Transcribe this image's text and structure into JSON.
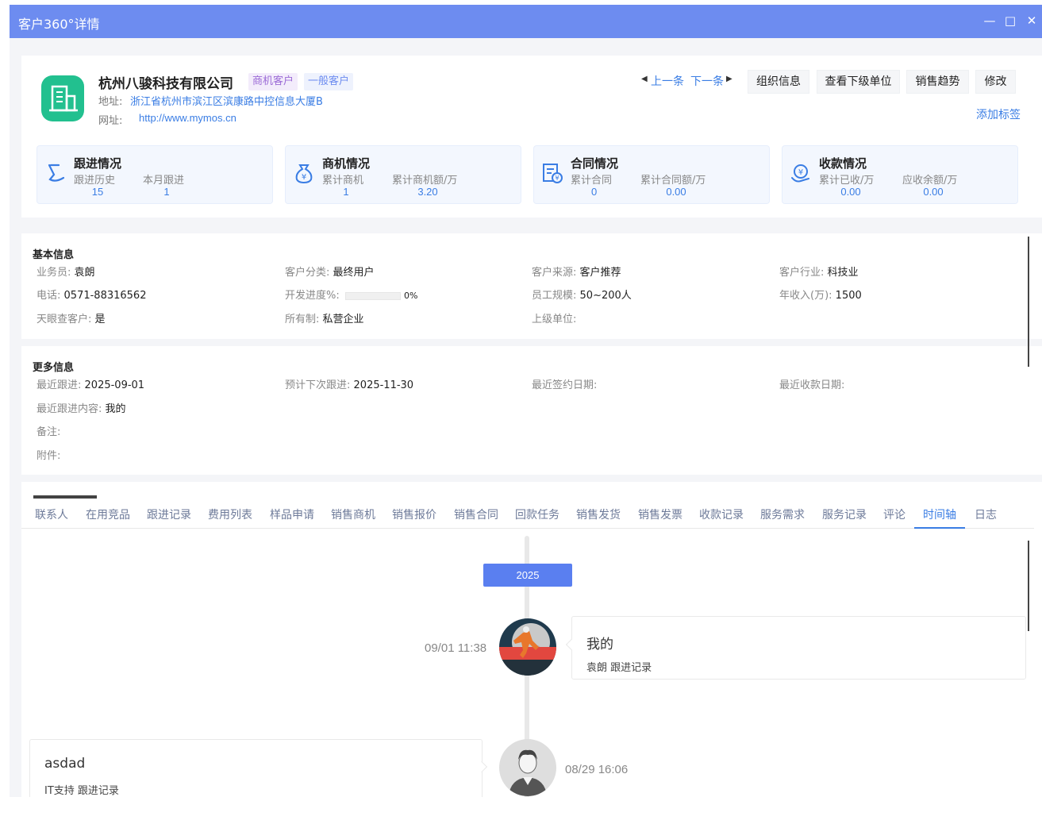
{
  "window": {
    "title": "客户360°详情"
  },
  "company": {
    "name": "杭州八骏科技有限公司",
    "tag1": "商机客户",
    "tag2": "一般客户",
    "address_label": "地址:",
    "address": "浙江省杭州市滨江区滨康路中控信息大厦B",
    "url_label": "网址:",
    "url": "http://www.mymos.cn"
  },
  "nav": {
    "prev": "上一条",
    "next": "下一条"
  },
  "buttons": {
    "org_info": "组织信息",
    "sub_units": "查看下级单位",
    "sales_trend": "销售趋势",
    "edit": "修改",
    "add_tag": "添加标签"
  },
  "cards": [
    {
      "title": "跟进情况",
      "label1": "跟进历史",
      "value1": "15",
      "label2": "本月跟进",
      "value2": "1"
    },
    {
      "title": "商机情况",
      "label1": "累计商机",
      "value1": "1",
      "label2": "累计商机额/万",
      "value2": "3.20"
    },
    {
      "title": "合同情况",
      "label1": "累计合同",
      "value1": "0",
      "label2": "累计合同额/万",
      "value2": "0.00"
    },
    {
      "title": "收款情况",
      "label1": "累计已收/万",
      "value1": "0.00",
      "label2": "应收余额/万",
      "value2": "0.00"
    }
  ],
  "basic": {
    "title": "基本信息",
    "salesperson_k": "业务员:",
    "salesperson_v": "袁朗",
    "category_k": "客户分类:",
    "category_v": "最终用户",
    "source_k": "客户来源:",
    "source_v": "客户推荐",
    "industry_k": "客户行业:",
    "industry_v": "科技业",
    "phone_k": "电话:",
    "phone_v": "0571-88316562",
    "progress_k": "开发进度%:",
    "progress_v": "0%",
    "progress_fraction": 0,
    "staff_k": "员工规模:",
    "staff_v": "50~200人",
    "revenue_k": "年收入(万):",
    "revenue_v": "1500",
    "tianyan_k": "天眼查客户:",
    "tianyan_v": "是",
    "ownership_k": "所有制:",
    "ownership_v": "私营企业",
    "parent_k": "上级单位:",
    "parent_v": ""
  },
  "more": {
    "title": "更多信息",
    "last_follow_k": "最近跟进:",
    "last_follow_v": "2025-09-01",
    "next_follow_k": "预计下次跟进:",
    "next_follow_v": "2025-11-30",
    "last_sign_k": "最近签约日期:",
    "last_sign_v": "",
    "last_pay_k": "最近收款日期:",
    "last_pay_v": "",
    "last_content_k": "最近跟进内容:",
    "last_content_v": "我的",
    "remark_k": "备注:",
    "remark_v": "",
    "attach_k": "附件:",
    "attach_v": ""
  },
  "tabs": [
    "联系人",
    "在用竞品",
    "跟进记录",
    "费用列表",
    "样品申请",
    "销售商机",
    "销售报价",
    "销售合同",
    "回款任务",
    "销售发货",
    "销售发票",
    "收款记录",
    "服务需求",
    "服务记录",
    "评论",
    "时间轴",
    "日志"
  ],
  "timeline": {
    "year": "2025",
    "entries": [
      {
        "time": "09/01 11:38",
        "title": "我的",
        "sub": "袁朗 跟进记录"
      },
      {
        "time": "08/29 16:06",
        "title": "asdad",
        "sub": "IT支持 跟进记录"
      }
    ]
  },
  "colors": {
    "titlebar": "#6d8cf0",
    "accent": "#3a7de4",
    "logo": "#22c08f",
    "year_badge": "#5a7ff0"
  }
}
